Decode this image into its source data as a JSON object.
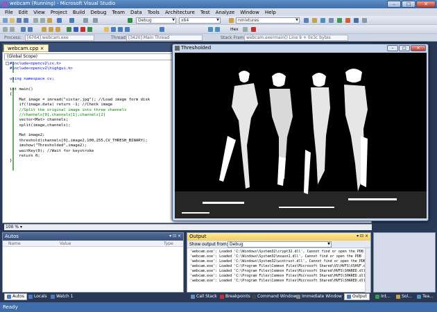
{
  "window": {
    "title": "webcam (Running) - Microsoft Visual Studio",
    "min": "–",
    "max": "□",
    "close": "✕"
  },
  "menu": [
    "File",
    "Edit",
    "View",
    "Project",
    "Build",
    "Debug",
    "Team",
    "Data",
    "Tools",
    "Architecture",
    "Test",
    "Analyze",
    "Window",
    "Help"
  ],
  "toolbar": {
    "config": "Debug",
    "platform": "x64",
    "find": "nmixtures",
    "hex": "Hex"
  },
  "debugbar": {
    "process_label": "Process:",
    "process": "[6764] webcam.exe",
    "thread_label": "Thread:",
    "thread": "[3420] Main Thread",
    "frame_label": "Stack Frame:",
    "frame": "webcam.exe!main()  Line 9 + 0x3c bytes"
  },
  "editor": {
    "tab": "webcam.cpp",
    "tab_close": "×",
    "scope": "(Global Scope)",
    "zoom": "100 %",
    "lines": [
      {
        "t": "#include<opencv2\\cv.h>",
        "c": "kw"
      },
      {
        "t": "#include<opencv2\\highgui.h>",
        "c": "kw"
      },
      {
        "t": "",
        "c": ""
      },
      {
        "t": "using namespace cv;",
        "c": "kw"
      },
      {
        "t": "",
        "c": ""
      },
      {
        "t": "int main()",
        "c": ""
      },
      {
        "t": "{",
        "c": ""
      },
      {
        "t": "    Mat image = imread(\"sistar.jpg\"); //Load image form disk",
        "c": ""
      },
      {
        "t": "    if(!image.data) return -1; //Check image",
        "c": ""
      },
      {
        "t": "    //Split the original image into three channels",
        "c": "cm"
      },
      {
        "t": "    //channels[0],channels[1],channels[2]",
        "c": "cm"
      },
      {
        "t": "    vector<Mat> channels;",
        "c": ""
      },
      {
        "t": "    split(image,channels);",
        "c": ""
      },
      {
        "t": "",
        "c": ""
      },
      {
        "t": "    Mat image2;",
        "c": ""
      },
      {
        "t": "    threshold(channels[0],image2,100,255,CV_THRESH_BINARY);",
        "c": ""
      },
      {
        "t": "    imshow(\"Thresholded\",image2);",
        "c": ""
      },
      {
        "t": "    waitKey(0); //Wait for keystroke",
        "c": ""
      },
      {
        "t": "    return 0;",
        "c": ""
      },
      {
        "t": "}",
        "c": ""
      }
    ]
  },
  "cvwindow": {
    "title": "Thresholded",
    "min": "–",
    "max": "□",
    "close": "✕"
  },
  "autos": {
    "title": "Autos",
    "pin": "▾ ⊡ ×",
    "cols": [
      "Name",
      "Value",
      "Type"
    ]
  },
  "output": {
    "title": "Output",
    "pin": "▾ ⊡ ×",
    "show_from_label": "Show output from:",
    "show_from": "Debug",
    "lines": [
      "'webcam.exe': Loaded 'C:\\Windows\\System32\\crypt32.dll', Cannot find or open the PDB",
      "'webcam.exe': Loaded 'C:\\Windows\\System32\\msasn1.dll', Cannot find or open the PDB",
      "'webcam.exe': Loaded 'C:\\Windows\\System32\\wintrust.dll', Cannot find or open the PDB",
      "'webcam.exe': Loaded 'C:\\Program Files\\Common Files\\Microsoft Shared\\VS\\HVFS\\VSHVF.dll'",
      "'webcam.exe': Loaded 'C:\\Program Files\\Common Files\\Microsoft Shared\\HVFS\\SHARED.dll'",
      "'webcam.exe': Loaded 'C:\\Program Files\\Common Files\\Microsoft Shared\\HVFS\\SHARED.dll'",
      "'webcam.exe': Loaded 'C:\\Program Files\\Common Files\\Microsoft Shared\\HVFS\\SHARED.dll'"
    ]
  },
  "bottom_tabs_left": [
    "Autos",
    "Locals",
    "Watch 1"
  ],
  "bottom_tabs_right": [
    "Call Stack",
    "Breakpoints",
    "Command Window",
    "Immediate Window",
    "Output"
  ],
  "side_tabs": [
    "Int...",
    "Sol...",
    "Tea..."
  ],
  "status": "Ready"
}
